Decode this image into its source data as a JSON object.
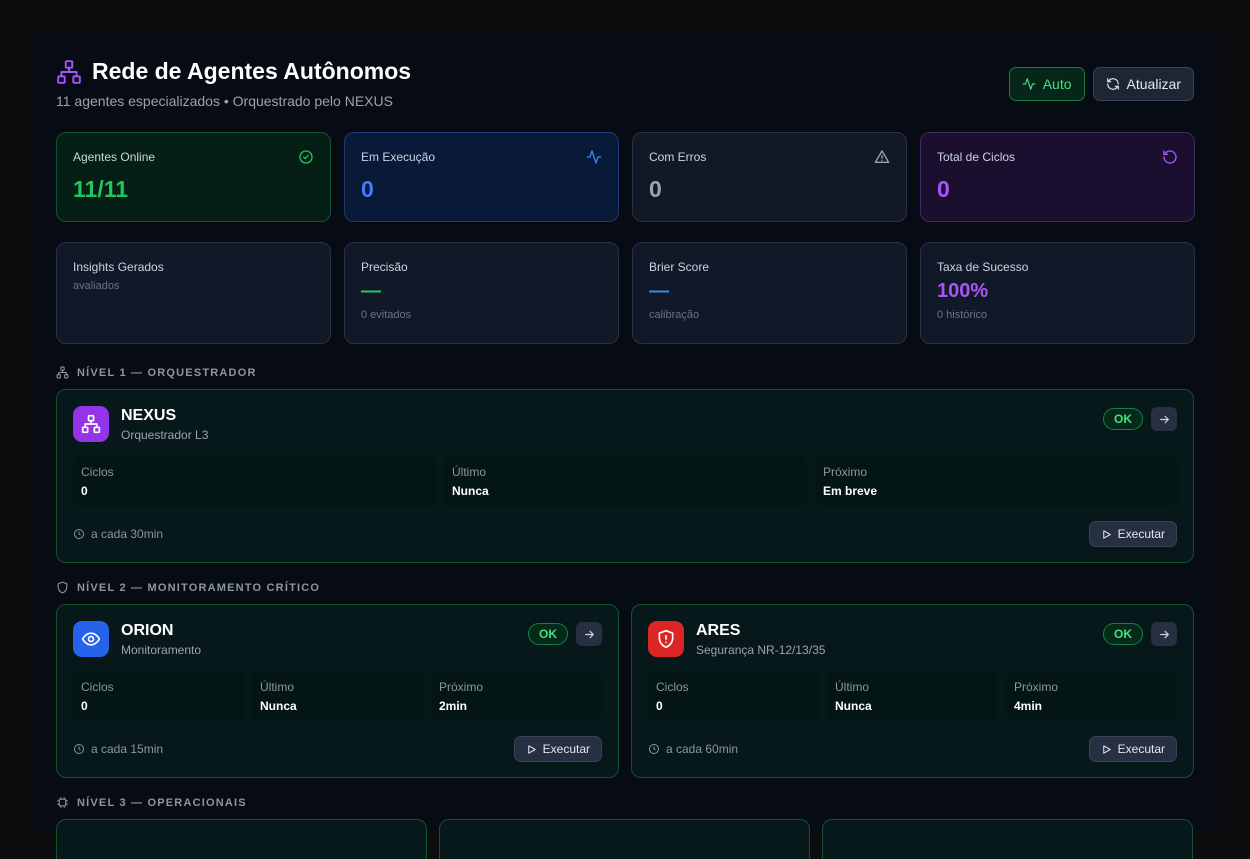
{
  "header": {
    "title": "Rede de Agentes Autônomos",
    "subtitle": "11 agentes especializados • Orquestrado pelo NEXUS",
    "auto_label": "Auto",
    "refresh_label": "Atualizar"
  },
  "stats": [
    {
      "label": "Agentes Online",
      "value": "11/11",
      "icon": "check-circle-icon",
      "color": "#22c55e"
    },
    {
      "label": "Em Execução",
      "value": "0",
      "icon": "activity-icon",
      "color": "#3b82f6"
    },
    {
      "label": "Com Erros",
      "value": "0",
      "icon": "alert-triangle-icon",
      "color": "#9ca3af"
    },
    {
      "label": "Total de Ciclos",
      "value": "0",
      "icon": "rotate-icon",
      "color": "#a855f7"
    }
  ],
  "metrics": [
    {
      "label": "Insights Gerados",
      "sub": "avaliados"
    },
    {
      "label": "Precisão",
      "value": "—",
      "note": "0 evitados",
      "color": "#22c55e"
    },
    {
      "label": "Brier Score",
      "value": "—",
      "note": "calibração",
      "color": "#3b82f6"
    },
    {
      "label": "Taxa de Sucesso",
      "value": "100%",
      "note": "0 histórico",
      "color": "#a855f7"
    }
  ],
  "levels": {
    "l1": "NÍVEL 1 — ORQUESTRADOR",
    "l2": "NÍVEL 2 — MONITORAMENTO CRÍTICO",
    "l3": "NÍVEL 3 — OPERACIONAIS"
  },
  "labels": {
    "cycles": "Ciclos",
    "last": "Último",
    "next": "Próximo",
    "execute": "Executar",
    "status_ok": "OK"
  },
  "agents": {
    "nexus": {
      "name": "NEXUS",
      "role": "Orquestrador L3",
      "cycles": "0",
      "last": "Nunca",
      "next": "Em breve",
      "freq": "a cada 30min",
      "icon": "network-icon",
      "color": "#9333ea"
    },
    "orion": {
      "name": "ORION",
      "role": "Monitoramento",
      "cycles": "0",
      "last": "Nunca",
      "next": "2min",
      "freq": "a cada 15min",
      "icon": "eye-icon",
      "color": "#2563eb"
    },
    "ares": {
      "name": "ARES",
      "role": "Segurança NR-12/13/35",
      "cycles": "0",
      "last": "Nunca",
      "next": "4min",
      "freq": "a cada 60min",
      "icon": "shield-alert-icon",
      "color": "#dc2626"
    }
  }
}
